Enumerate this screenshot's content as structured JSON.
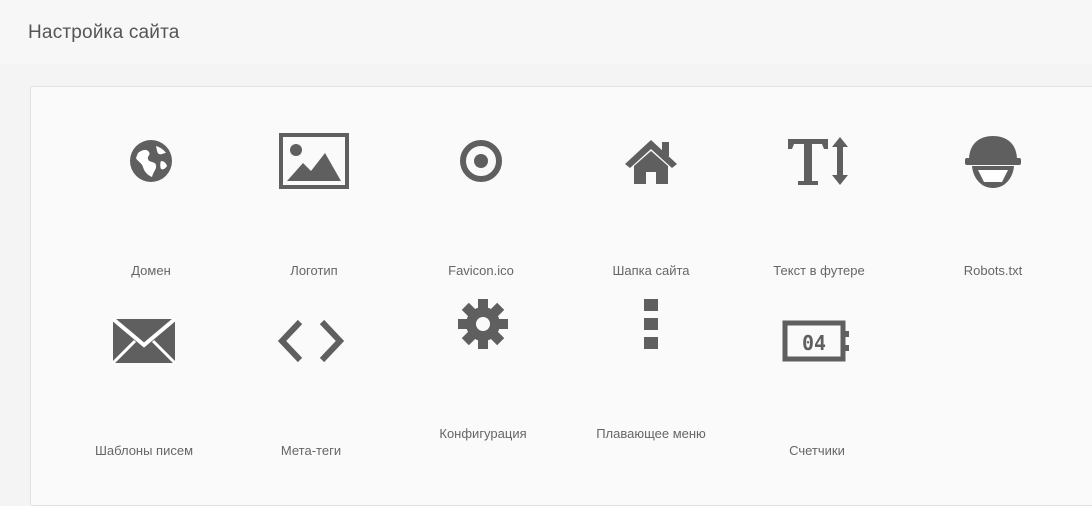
{
  "header": {
    "title": "Настройка сайта"
  },
  "tiles": [
    {
      "name": "tile-domain",
      "icon": "globe-icon",
      "label": "Домен"
    },
    {
      "name": "tile-logo",
      "icon": "image-icon",
      "label": "Логотип"
    },
    {
      "name": "tile-favicon",
      "icon": "dot-circle-icon",
      "label": "Favicon.ico"
    },
    {
      "name": "tile-header",
      "icon": "home-icon",
      "label": "Шапка сайта"
    },
    {
      "name": "tile-footer-text",
      "icon": "text-height-icon",
      "label": "Текст в футере"
    },
    {
      "name": "tile-robots",
      "icon": "robot-helmet-icon",
      "label": "Robots.txt"
    },
    {
      "name": "tile-email-templates",
      "icon": "envelope-icon",
      "label": "Шаблоны писем"
    },
    {
      "name": "tile-meta-tags",
      "icon": "code-icon",
      "label": "Мета-теги"
    },
    {
      "name": "tile-configuration",
      "icon": "gear-icon",
      "label": "Конфигурация"
    },
    {
      "name": "tile-floating-menu",
      "icon": "ellipsis-vertical-icon",
      "label": "Плавающее меню"
    },
    {
      "name": "tile-counters",
      "icon": "counter-icon",
      "label": "Счетчики"
    }
  ],
  "counter_icon_text": "04"
}
